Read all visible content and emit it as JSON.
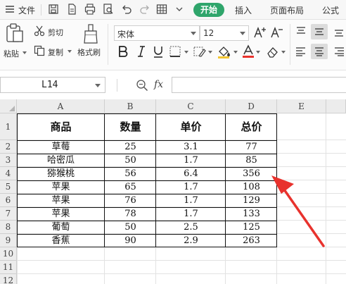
{
  "menubar": {
    "file_label": "文件",
    "tabs": [
      "开始",
      "插入",
      "页面布局",
      "公式"
    ]
  },
  "ribbon": {
    "paste_label": "粘贴",
    "cut_label": "剪切",
    "copy_label": "复制",
    "format_painter_label": "格式刷",
    "font_name": "宋体",
    "font_size": "12"
  },
  "formula_bar": {
    "cell_ref": "L14",
    "fx_label": "fx",
    "content": ""
  },
  "sheet": {
    "columns": [
      "A",
      "B",
      "C",
      "D",
      "E"
    ],
    "rows": [
      "1",
      "2",
      "3",
      "4",
      "5",
      "6",
      "7",
      "8",
      "9",
      "10",
      "11",
      "12"
    ],
    "headers": [
      "商品",
      "数量",
      "单价",
      "总价"
    ],
    "data": [
      [
        "草莓",
        "25",
        "3.1",
        "77"
      ],
      [
        "哈密瓜",
        "50",
        "1.7",
        "85"
      ],
      [
        "猕猴桃",
        "56",
        "6.4",
        "356"
      ],
      [
        "苹果",
        "65",
        "1.7",
        "108"
      ],
      [
        "苹果",
        "76",
        "1.7",
        "129"
      ],
      [
        "苹果",
        "78",
        "1.7",
        "133"
      ],
      [
        "葡萄",
        "50",
        "2.5",
        "125"
      ],
      [
        "香蕉",
        "90",
        "2.9",
        "263"
      ]
    ]
  },
  "colors": {
    "accent_green": "#2fa56b",
    "arrow_red": "#e8322d"
  }
}
